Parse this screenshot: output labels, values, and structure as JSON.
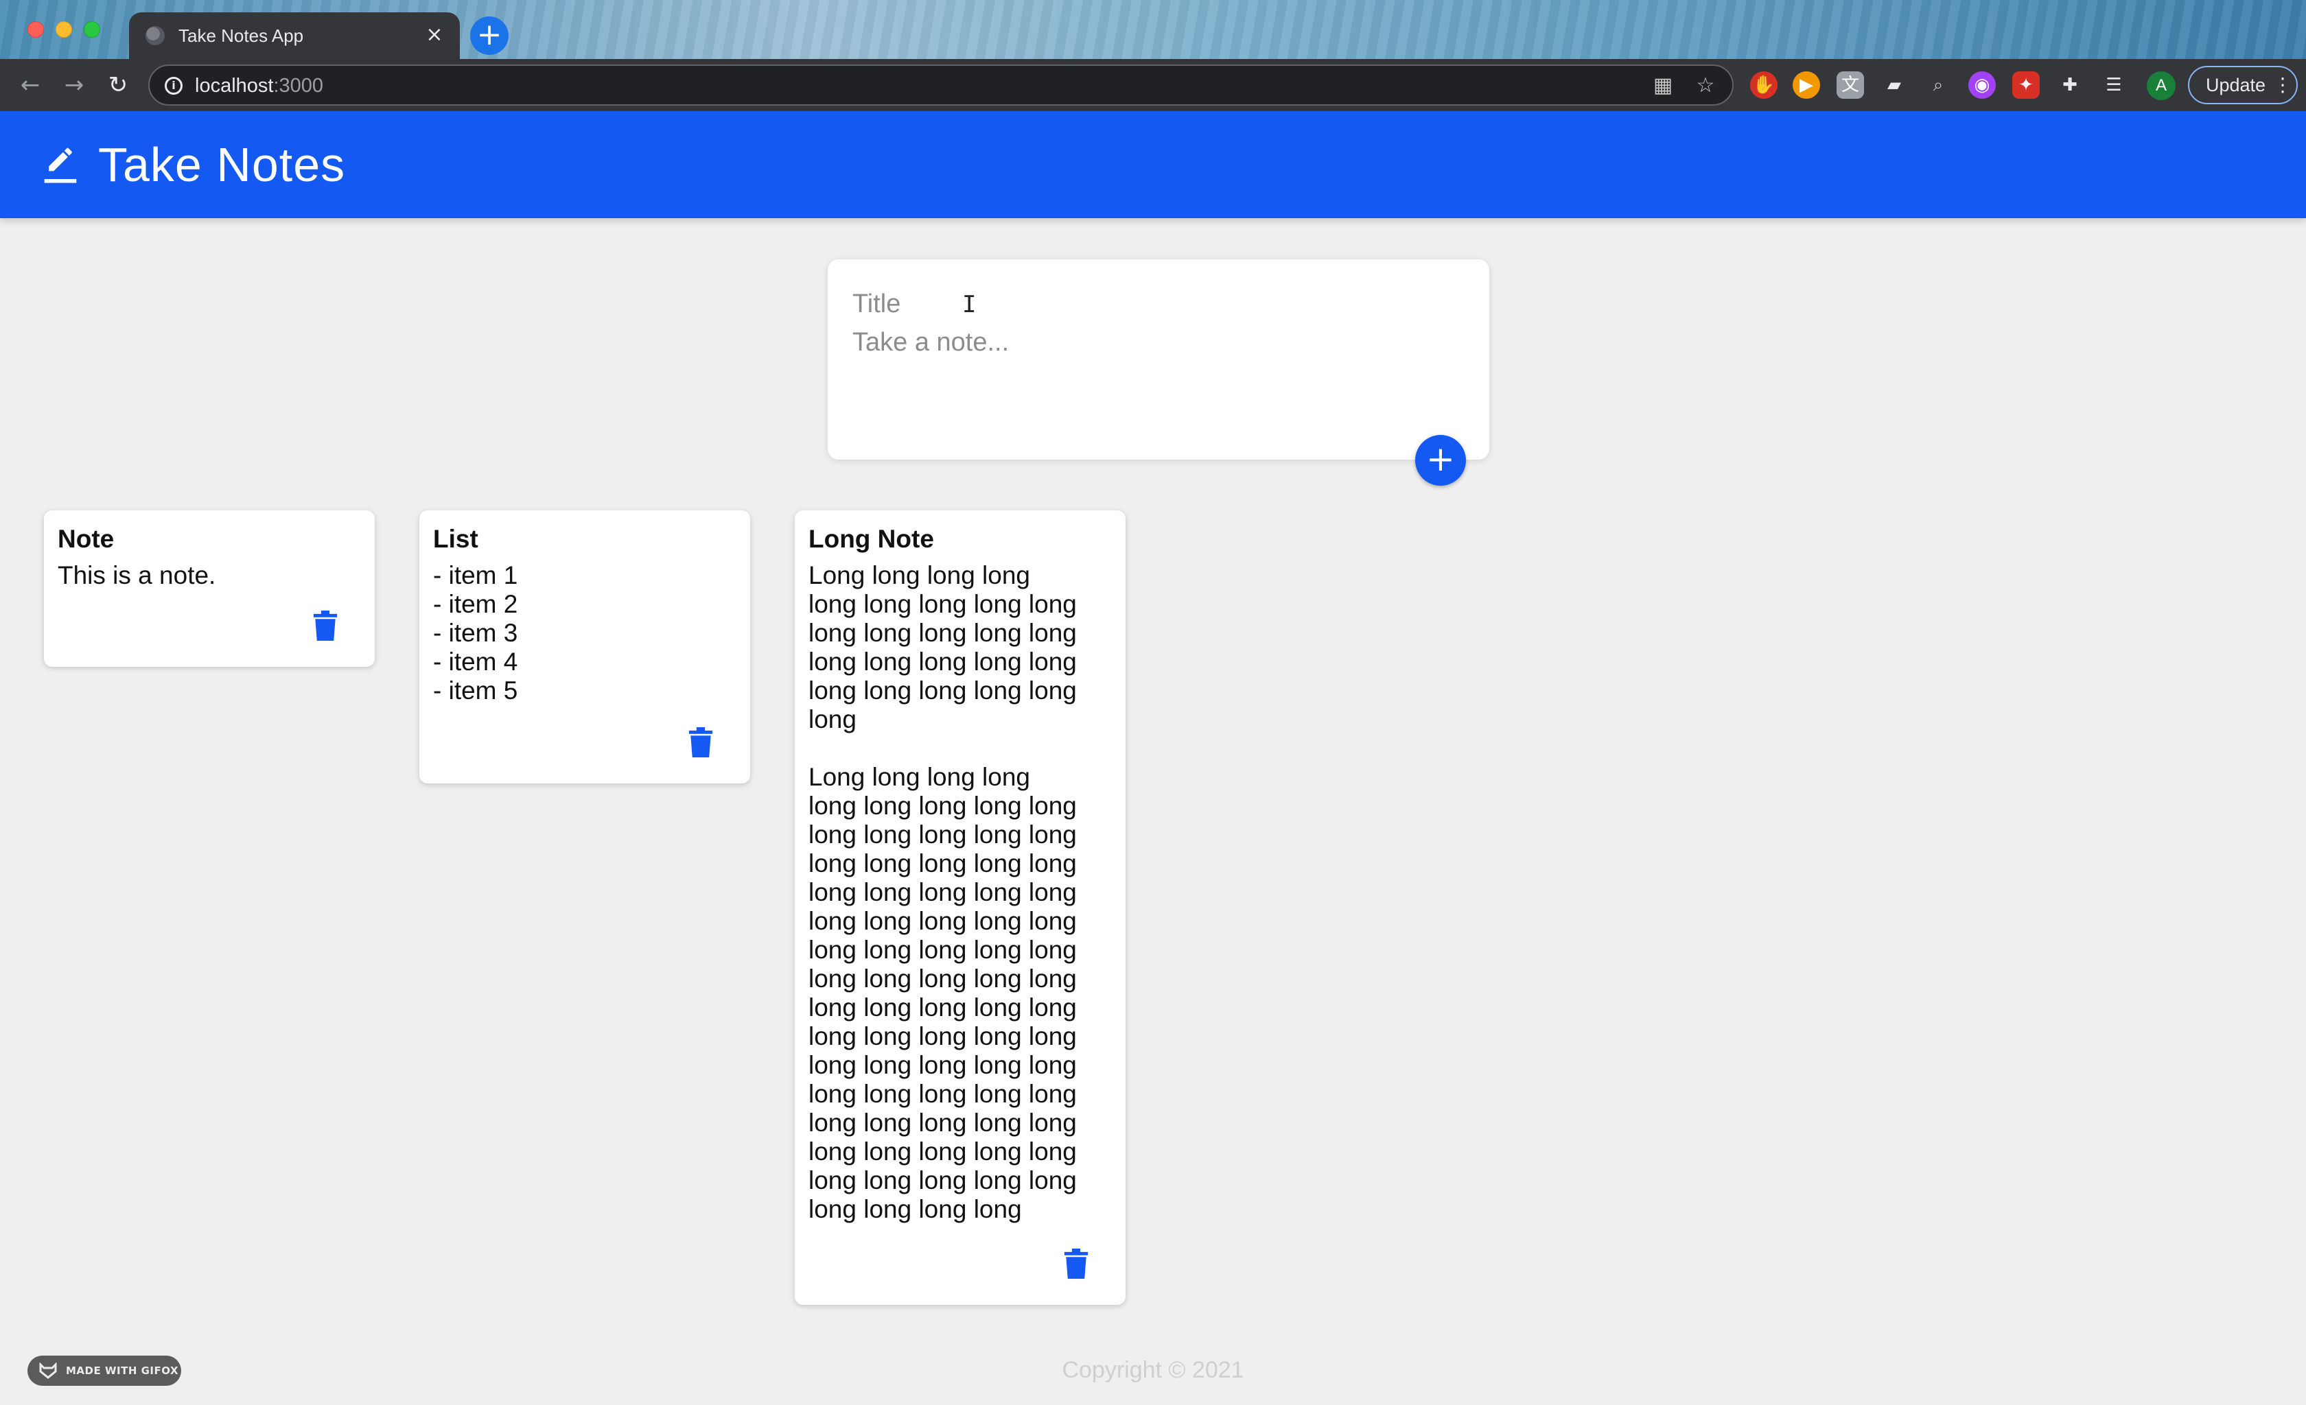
{
  "browser": {
    "tab_title": "Take Notes App",
    "tab_close": "×",
    "new_tab": "+",
    "url_host": "localhost",
    "url_port": ":3000",
    "update_label": "Update",
    "profile_initial": "A",
    "extensions": [
      "adblock-icon",
      "play-icon",
      "translate-icon",
      "reader-icon",
      "search-icon",
      "color-icon",
      "gift-icon",
      "puzzle-icon",
      "playlist-icon"
    ]
  },
  "app": {
    "title": "Take Notes",
    "accent_color": "#1359f2"
  },
  "create_note": {
    "title_placeholder": "Title",
    "body_placeholder": "Take a note...",
    "add_label": "+"
  },
  "notes": [
    {
      "title": "Note",
      "content": "This is a note."
    },
    {
      "title": "List",
      "content": "- item 1\n- item 2\n- item 3\n- item 4\n- item 5"
    },
    {
      "title": "Long Note",
      "content": "Long long long long\nlong long long long long\nlong long long long long\nlong long long long long\nlong long long long long\nlong\n\nLong long long long\nlong long long long long\nlong long long long long\nlong long long long long\nlong long long long long\nlong long long long long\nlong long long long long\nlong long long long long\nlong long long long long\nlong long long long long\nlong long long long long\nlong long long long long\nlong long long long long\nlong long long long long\nlong long long long long\nlong long long long"
    }
  ],
  "footer": {
    "copyright": "Copyright © 2021",
    "badge": "MADE WITH GIFOX"
  }
}
